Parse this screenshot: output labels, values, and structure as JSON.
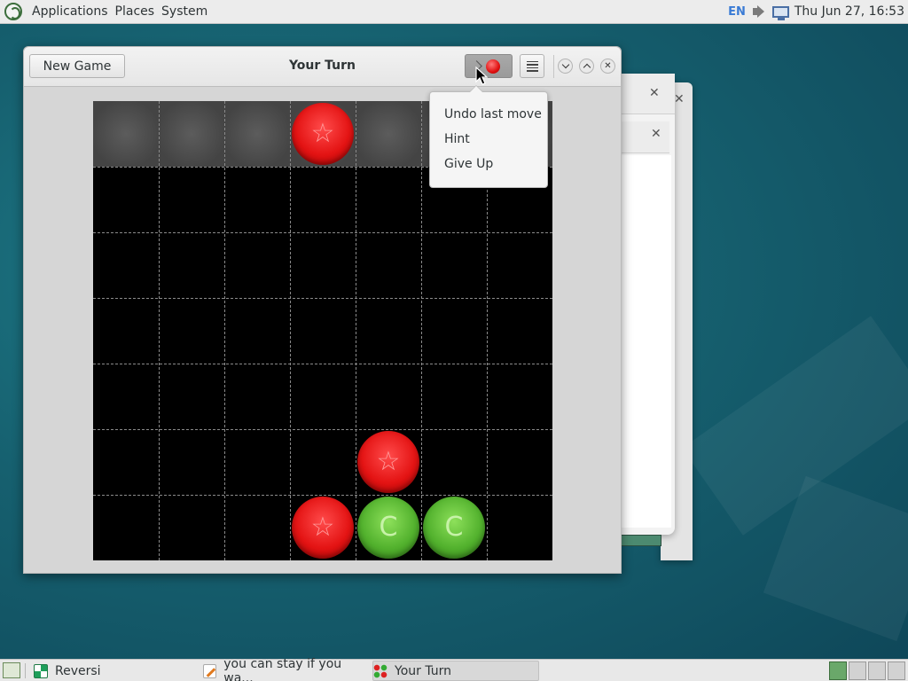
{
  "top_panel": {
    "menus": [
      "Applications",
      "Places",
      "System"
    ],
    "keyboard_layout": "EN",
    "clock": "Thu Jun 27, 16:53"
  },
  "game_window": {
    "new_game_label": "New Game",
    "title": "Your Turn",
    "game_menu": {
      "items": [
        "Undo last move",
        "Hint",
        "Give Up"
      ]
    }
  },
  "board": {
    "columns": 7,
    "rows": 7,
    "cells": [
      {
        "row": 1,
        "col": 4,
        "color": "red",
        "symbol": "☆"
      },
      {
        "row": 6,
        "col": 5,
        "color": "red",
        "symbol": "☆"
      },
      {
        "row": 7,
        "col": 4,
        "color": "red",
        "symbol": "☆"
      },
      {
        "row": 7,
        "col": 5,
        "color": "green",
        "symbol": "C"
      },
      {
        "row": 7,
        "col": 6,
        "color": "green",
        "symbol": "C"
      }
    ],
    "colors": {
      "player1": "#e41414",
      "player2": "#53b22e",
      "background": "#000000"
    }
  },
  "taskbar": {
    "tasks": [
      "Reversi",
      "you can stay if you wa...",
      "Your Turn"
    ],
    "active_task": "Your Turn",
    "workspaces": 4
  }
}
